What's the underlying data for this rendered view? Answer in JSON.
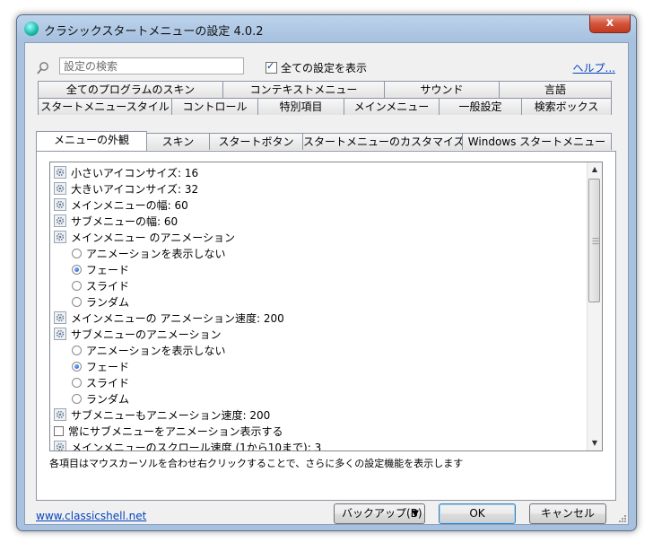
{
  "window": {
    "title": "クラシックスタートメニューの設定 4.0.2",
    "close_label": "x"
  },
  "search": {
    "placeholder": "設定の検索"
  },
  "show_all": {
    "label": "全ての設定を表示",
    "checked": true
  },
  "help": {
    "label": "ヘルプ..."
  },
  "tabs_row1": [
    "全てのプログラムのスキン",
    "コンテキストメニュー",
    "サウンド",
    "言語"
  ],
  "tabs_row2": [
    "スタートメニュースタイル",
    "コントロール",
    "特別項目",
    "メインメニュー",
    "一般設定",
    "検索ボックス"
  ],
  "tabs_row3": [
    "メニューの外観",
    "スキン",
    "スタートボタン",
    "スタートメニューのカスタマイズ",
    "Windows スタートメニュー"
  ],
  "active_tab": "メニューの外観",
  "settings": [
    {
      "type": "gear",
      "text": "小さいアイコンサイズ: 16"
    },
    {
      "type": "gear",
      "text": "大きいアイコンサイズ: 32"
    },
    {
      "type": "gear",
      "text": "メインメニューの幅: 60"
    },
    {
      "type": "gear",
      "text": "サブメニューの幅: 60"
    },
    {
      "type": "gear",
      "text": "メインメニュー のアニメーション"
    },
    {
      "type": "radio",
      "text": "アニメーションを表示しない",
      "selected": false
    },
    {
      "type": "radio",
      "text": "フェード",
      "selected": true
    },
    {
      "type": "radio",
      "text": "スライド",
      "selected": false
    },
    {
      "type": "radio",
      "text": "ランダム",
      "selected": false
    },
    {
      "type": "gear",
      "text": "メインメニューの アニメーション速度: 200"
    },
    {
      "type": "gear",
      "text": "サブメニューのアニメーション"
    },
    {
      "type": "radio",
      "text": "アニメーションを表示しない",
      "selected": false
    },
    {
      "type": "radio",
      "text": "フェード",
      "selected": true
    },
    {
      "type": "radio",
      "text": "スライド",
      "selected": false
    },
    {
      "type": "radio",
      "text": "ランダム",
      "selected": false
    },
    {
      "type": "gear",
      "text": "サブメニューもアニメーション速度: 200"
    },
    {
      "type": "checkbox",
      "text": "常にサブメニューをアニメーション表示する",
      "checked": false
    },
    {
      "type": "gear",
      "text": "メインメニューのスクロール速度 (1から10まで): 3"
    }
  ],
  "hint": "各項目はマウスカーソルを合わせ右クリックすることで、さらに多くの設定機能を表示します",
  "footer": {
    "site_link": "www.classicshell.net",
    "backup_label": "バックアップ(B)",
    "ok_label": "OK",
    "cancel_label": "キャンセル"
  }
}
